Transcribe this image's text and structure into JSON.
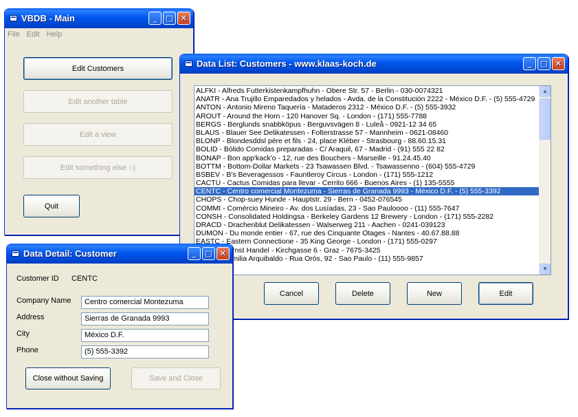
{
  "main_window": {
    "title": "VBDB - Main",
    "menu": [
      "File",
      "Edit",
      "Help"
    ],
    "buttons": {
      "edit_customers": "Edit Customers",
      "edit_another_table": "Edit another table",
      "edit_view": "Edit a view",
      "edit_else": "Edit something else :-)",
      "quit": "Quit"
    }
  },
  "list_window": {
    "title": "Data List: Customers - www.klaas-koch.de",
    "rows": [
      "ALFKI - Alfreds Futterkistenkampfhuhn - Obere Str. 57 - Berlin - 030-0074321",
      "ANATR - Ana Trujillo Emparedados y helados - Avda. de la Constitución 2222 - México D.F. - (5) 555-4729",
      "ANTON - Antonio Mireno Taquería - Mataderos  2312 - México D.F. - (5) 555-3932",
      "AROUT - Around the Horn - 120 Hanover Sq. - London - (171) 555-7788",
      "BERGS - Berglunds snabbköpus - Berguvsvägen  8 - Luleå - 0921-12 34 65",
      "BLAUS - Blauer See Delikatessen - Folterstrasse 57 - Mannheim - 0621-08460",
      "BLONP - Blondesddsl père et fils - 24, place Kléber - Strasbourg - 88.60.15.31",
      "BOLID - Bólido Comidas preparadas - C/ Araquil, 67 - Madrid - (91) 555 22 82",
      "BONAP - Bon app'kack'o - 12, rue des Bouchers - Marseille - 91.24.45.40",
      "BOTTM - Bottom-Dollar Markets - 23 Tsawassen Blvd. - Tsawassenno - (604) 555-4729",
      "BSBEV - B's Beveragessos - Fauntleroy Circus - London - (171) 555-1212",
      "CACTU - Cactus Comidas para llevar - Cerrito 666 - Buenos Aires - (1) 135-5555",
      "CENTC - Centro comercial Montezuma - Sierras de Granada 9993 - México D.F. - (5) 555-3392",
      "CHOPS - Chop-suey Hunde - Hauptstr. 29 - Bern - 0452-076545",
      "COMMI - Comércio Mineiro - Av. dos Lusíadas, 23 - Sao Pauloooo - (11) 555-7647",
      "CONSH - Consolidated Holdingsa - Berkeley Gardens 12  Brewery - London - (171) 555-2282",
      "DRACD - Drachenblut Delikatessen - Walserweg 211 - Aachen - 0241-039123",
      "DUMON - Du monde entier - 67, rue des Cinquante Otages - Nantes - 40.67.88.88",
      "EASTC - Eastern Connectione - 35 King George - London - (171) 555-0297",
      "ERNSH - Ernst Handel - Kirchgasse 6 - Graz - 7675-3425",
      "FAMIA - Familia Arquibaldo - Rua Orós, 92 - Sao Paulo - (11) 555-9857"
    ],
    "selected_index": 12,
    "buttons": {
      "cancel": "Cancel",
      "delete": "Delete",
      "new": "New",
      "edit": "Edit"
    }
  },
  "detail_window": {
    "title": "Data Detail: Customer",
    "customer_id_label": "Customer ID",
    "customer_id_value": "CENTC",
    "fields": {
      "company_label": "Company Name",
      "company_value": "Centro comercial Montezuma",
      "address_label": "Address",
      "address_value": "Sierras de Granada 9993",
      "city_label": "City",
      "city_value": "México D.F.",
      "phone_label": "Phone",
      "phone_value": "(5) 555-3392"
    },
    "buttons": {
      "close_without_saving": "Close without Saving",
      "save_and_close": "Save and Close"
    }
  },
  "icons": {
    "minimize": "minimize-icon",
    "maximize": "maximize-icon",
    "close": "close-icon",
    "app": "app-window-icon",
    "scroll_up": "scroll-up-icon",
    "scroll_down": "scroll-down-icon"
  },
  "colors": {
    "titlebar": "#0058EE",
    "window_bg": "#ECE9D8",
    "selection": "#316AC5"
  }
}
